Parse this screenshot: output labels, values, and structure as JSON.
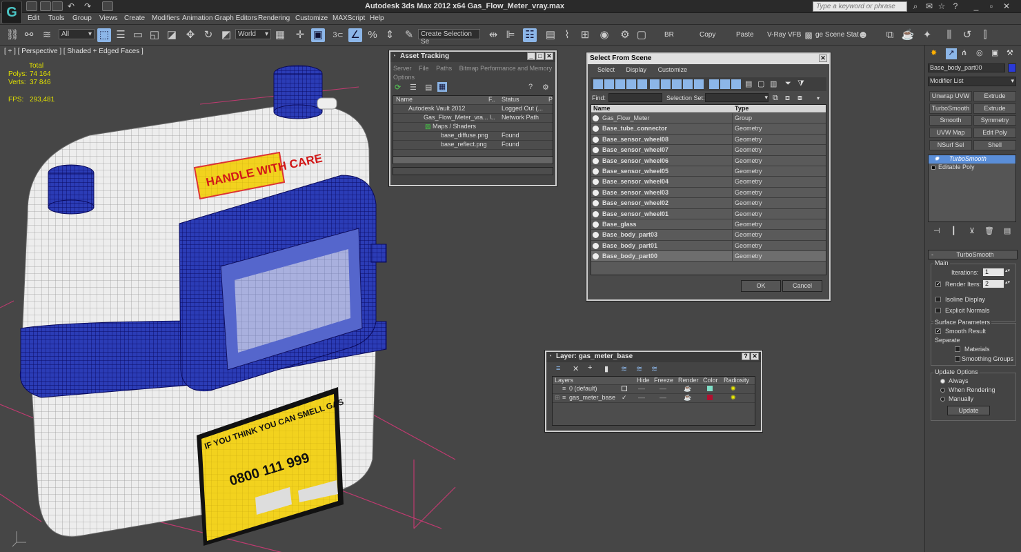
{
  "app": {
    "title": "Autodesk 3ds Max  2012 x64      Gas_Flow_Meter_vray.max",
    "logo_glyph": "G",
    "search_placeholder": "Type a keyword or phrase"
  },
  "menu": [
    "Edit",
    "Tools",
    "Group",
    "Views",
    "Create",
    "Modifiers",
    "Animation",
    "Graph Editors",
    "Rendering",
    "Customize",
    "MAXScript",
    "Help"
  ],
  "toolbar": {
    "selection_filter": "All",
    "ref_coord": "World",
    "named_selection": "Create Selection Se",
    "snap_angle": "3",
    "labels": {
      "br": "BR",
      "copy": "Copy",
      "paste": "Paste",
      "vray_vfb": "V-Ray VFB",
      "scene_states": "ge Scene Stat"
    }
  },
  "viewport": {
    "label": "[ + ] [ Perspective ] [ Shaded + Edged Faces ]",
    "stats_header": "Total",
    "polys_label": "Polys:",
    "polys": "74 164",
    "verts_label": "Verts:",
    "verts": "37 846",
    "fps_label": "FPS:",
    "fps": "293,481",
    "decal_handle": "HANDLE WITH CARE",
    "decal_smell": "IF YOU THINK YOU CAN SMELL GAS",
    "decal_phone": "0800 111 999"
  },
  "asset_tracking": {
    "title": "Asset Tracking",
    "menu": [
      "Server",
      "File",
      "Paths",
      "Bitmap Performance and Memory",
      "Options"
    ],
    "columns": {
      "name": "Name",
      "f": "F..",
      "status": "Status",
      "p": "P"
    },
    "rows": [
      {
        "name": "Autodesk Vault 2012",
        "f": "",
        "status": "Logged Out (...",
        "indent": 0
      },
      {
        "name": "Gas_Flow_Meter_vra...",
        "f": "\\..",
        "status": "Network Path",
        "indent": 1
      },
      {
        "name": "Maps / Shaders",
        "f": "",
        "status": "",
        "indent": 2
      },
      {
        "name": "base_diffuse.png",
        "f": "",
        "status": "Found",
        "indent": 3
      },
      {
        "name": "base_reflect.png",
        "f": "",
        "status": "Found",
        "indent": 3
      }
    ]
  },
  "select_from_scene": {
    "title": "Select From Scene",
    "menu": [
      "Select",
      "Display",
      "Customize"
    ],
    "find_label": "Find:",
    "selection_set_label": "Selection Set:",
    "columns": {
      "name": "Name",
      "type": "Type"
    },
    "rows": [
      {
        "name": "Gas_Flow_Meter",
        "type": "Group",
        "bold": false,
        "selected": false
      },
      {
        "name": "Base_tube_connector",
        "type": "Geometry",
        "bold": true,
        "selected": false
      },
      {
        "name": "Base_sensor_wheel08",
        "type": "Geometry",
        "bold": true,
        "selected": false
      },
      {
        "name": "Base_sensor_wheel07",
        "type": "Geometry",
        "bold": true,
        "selected": false
      },
      {
        "name": "Base_sensor_wheel06",
        "type": "Geometry",
        "bold": true,
        "selected": false
      },
      {
        "name": "Base_sensor_wheel05",
        "type": "Geometry",
        "bold": true,
        "selected": false
      },
      {
        "name": "Base_sensor_wheel04",
        "type": "Geometry",
        "bold": true,
        "selected": false
      },
      {
        "name": "Base_sensor_wheel03",
        "type": "Geometry",
        "bold": true,
        "selected": false
      },
      {
        "name": "Base_sensor_wheel02",
        "type": "Geometry",
        "bold": true,
        "selected": false
      },
      {
        "name": "Base_sensor_wheel01",
        "type": "Geometry",
        "bold": true,
        "selected": false
      },
      {
        "name": "Base_glass",
        "type": "Geometry",
        "bold": true,
        "selected": false
      },
      {
        "name": "Base_body_part03",
        "type": "Geometry",
        "bold": true,
        "selected": false
      },
      {
        "name": "Base_body_part01",
        "type": "Geometry",
        "bold": true,
        "selected": false
      },
      {
        "name": "Base_body_part00",
        "type": "Geometry",
        "bold": true,
        "selected": true
      }
    ],
    "ok": "OK",
    "cancel": "Cancel"
  },
  "layer_dialog": {
    "title": "Layer: gas_meter_base",
    "columns": [
      "Layers",
      "Hide",
      "Freeze",
      "Render",
      "Color",
      "Radiosity"
    ],
    "rows": [
      {
        "name": "0 (default)",
        "active": false,
        "color": "#7fe0c8"
      },
      {
        "name": "gas_meter_base",
        "active": true,
        "color": "#b01030"
      }
    ]
  },
  "command_panel": {
    "object_name": "Base_body_part00",
    "object_color": "#2a3ad8",
    "modifier_list": "Modifier List",
    "modifier_buttons": [
      "Unwrap UVW",
      "Extrude",
      "TurboSmooth",
      "Extrude",
      "Smooth",
      "Symmetry",
      "UVW Map",
      "Edit Poly",
      "NSurf Sel",
      "Shell"
    ],
    "stack": [
      {
        "name": "TurboSmooth",
        "active": true
      },
      {
        "name": "Editable Poly",
        "active": false
      }
    ],
    "rollout_title": "TurboSmooth",
    "main_label": "Main",
    "iterations_label": "Iterations:",
    "iterations": "1",
    "render_iters_label": "Render Iters:",
    "render_iters": "2",
    "render_iters_checked": true,
    "isoline_label": "Isoline Display",
    "explicit_label": "Explicit Normals",
    "surface_label": "Surface Parameters",
    "smooth_result_label": "Smooth Result",
    "separate_label": "Separate",
    "materials_label": "Materials",
    "smoothing_groups_label": "Smoothing Groups",
    "update_options_label": "Update Options",
    "always_label": "Always",
    "when_rendering_label": "When Rendering",
    "manually_label": "Manually",
    "update_button": "Update"
  },
  "colors": {
    "accent": "#8cb6e8",
    "wire_blue": "#1a1ab0",
    "decal_yellow": "#f5d21a"
  }
}
